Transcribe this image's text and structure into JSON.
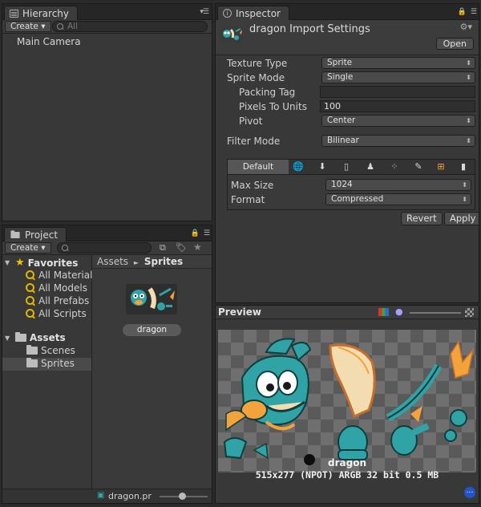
{
  "hierarchy": {
    "tab_label": "Hierarchy",
    "create_label": "Create ▾",
    "search_placeholder": "All",
    "items": [
      "Main Camera"
    ]
  },
  "inspector": {
    "tab_label": "Inspector",
    "title": "dragon Import Settings",
    "open_label": "Open",
    "fields": {
      "texture_type": {
        "label": "Texture Type",
        "value": "Sprite"
      },
      "sprite_mode": {
        "label": "Sprite Mode",
        "value": "Single"
      },
      "packing_tag": {
        "label": "Packing Tag",
        "value": ""
      },
      "pixels_to_units": {
        "label": "Pixels To Units",
        "value": "100"
      },
      "pivot": {
        "label": "Pivot",
        "value": "Center"
      },
      "filter_mode": {
        "label": "Filter Mode",
        "value": "Bilinear"
      }
    },
    "platforms": {
      "default_label": "Default",
      "icons": [
        "globe-icon",
        "download-icon",
        "ios-icon",
        "android-icon",
        "blackberry-icon",
        "flash-icon",
        "windows-icon",
        "phone-icon"
      ],
      "max_size": {
        "label": "Max Size",
        "value": "1024"
      },
      "format": {
        "label": "Format",
        "value": "Compressed"
      }
    },
    "revert_label": "Revert",
    "apply_label": "Apply"
  },
  "project": {
    "tab_label": "Project",
    "create_label": "Create ▾",
    "favorites_label": "Favorites",
    "favorites": [
      "All Materials",
      "All Models",
      "All Prefabs",
      "All Scripts"
    ],
    "assets_label": "Assets",
    "folders": [
      "Scenes",
      "Sprites"
    ],
    "breadcrumb_root": "Assets",
    "breadcrumb_sep": "►",
    "breadcrumb_current": "Sprites",
    "asset_name": "dragon",
    "bottom_file": "dragon.pr"
  },
  "preview": {
    "title": "Preview",
    "name": "dragon",
    "info": "515x277 (NPOT)  ARGB 32 bit   0.5 MB"
  },
  "colors": {
    "dragon_teal": "#2fa3a6",
    "dragon_orange": "#f4a23b",
    "dragon_cream": "#f2dcb0",
    "favorite_star": "#f2c200"
  }
}
